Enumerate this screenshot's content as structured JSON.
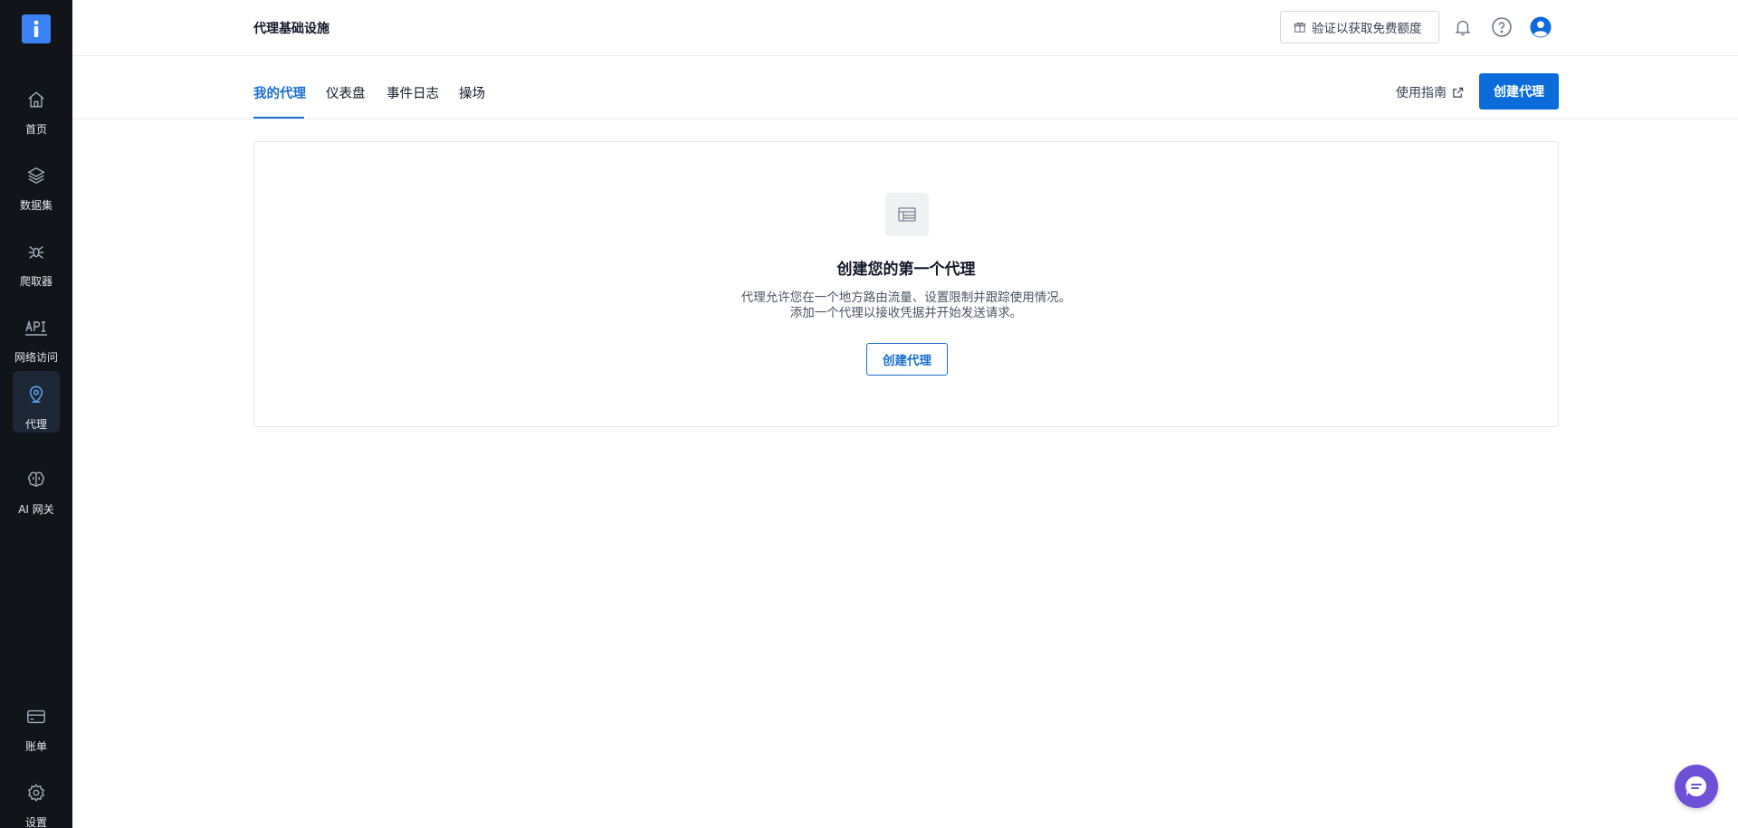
{
  "sidebar": {
    "items": [
      {
        "label": "首页",
        "icon": "home-icon"
      },
      {
        "label": "数据集",
        "icon": "layers-icon"
      },
      {
        "label": "爬取器",
        "icon": "spider-icon"
      },
      {
        "label": "网络访问",
        "icon": "api-icon"
      },
      {
        "label": "代理",
        "icon": "location-pin-icon",
        "active": true
      },
      {
        "label": "AI 网关",
        "icon": "brain-icon"
      }
    ],
    "bottom_items": [
      {
        "label": "账单",
        "icon": "billing-card-icon"
      },
      {
        "label": "设置",
        "icon": "gear-icon"
      }
    ]
  },
  "header": {
    "title": "代理基础设施",
    "verify_button": "验证以获取免费额度"
  },
  "tabs": [
    {
      "label": "我的代理",
      "active": true
    },
    {
      "label": "仪表盘"
    },
    {
      "label": "事件日志"
    },
    {
      "label": "操场"
    }
  ],
  "toolbar": {
    "guide_link": "使用指南",
    "create_button": "创建代理"
  },
  "empty_state": {
    "title": "创建您的第一个代理",
    "description_line1": "代理允许您在一个地方路由流量、设置限制并跟踪使用情况。",
    "description_line2": "添加一个代理以接收凭据并开始发送请求。",
    "button": "创建代理"
  },
  "colors": {
    "sidebar_bg": "#111418",
    "accent": "#0a6bd9",
    "chat_fab": "#6e4fd8"
  }
}
